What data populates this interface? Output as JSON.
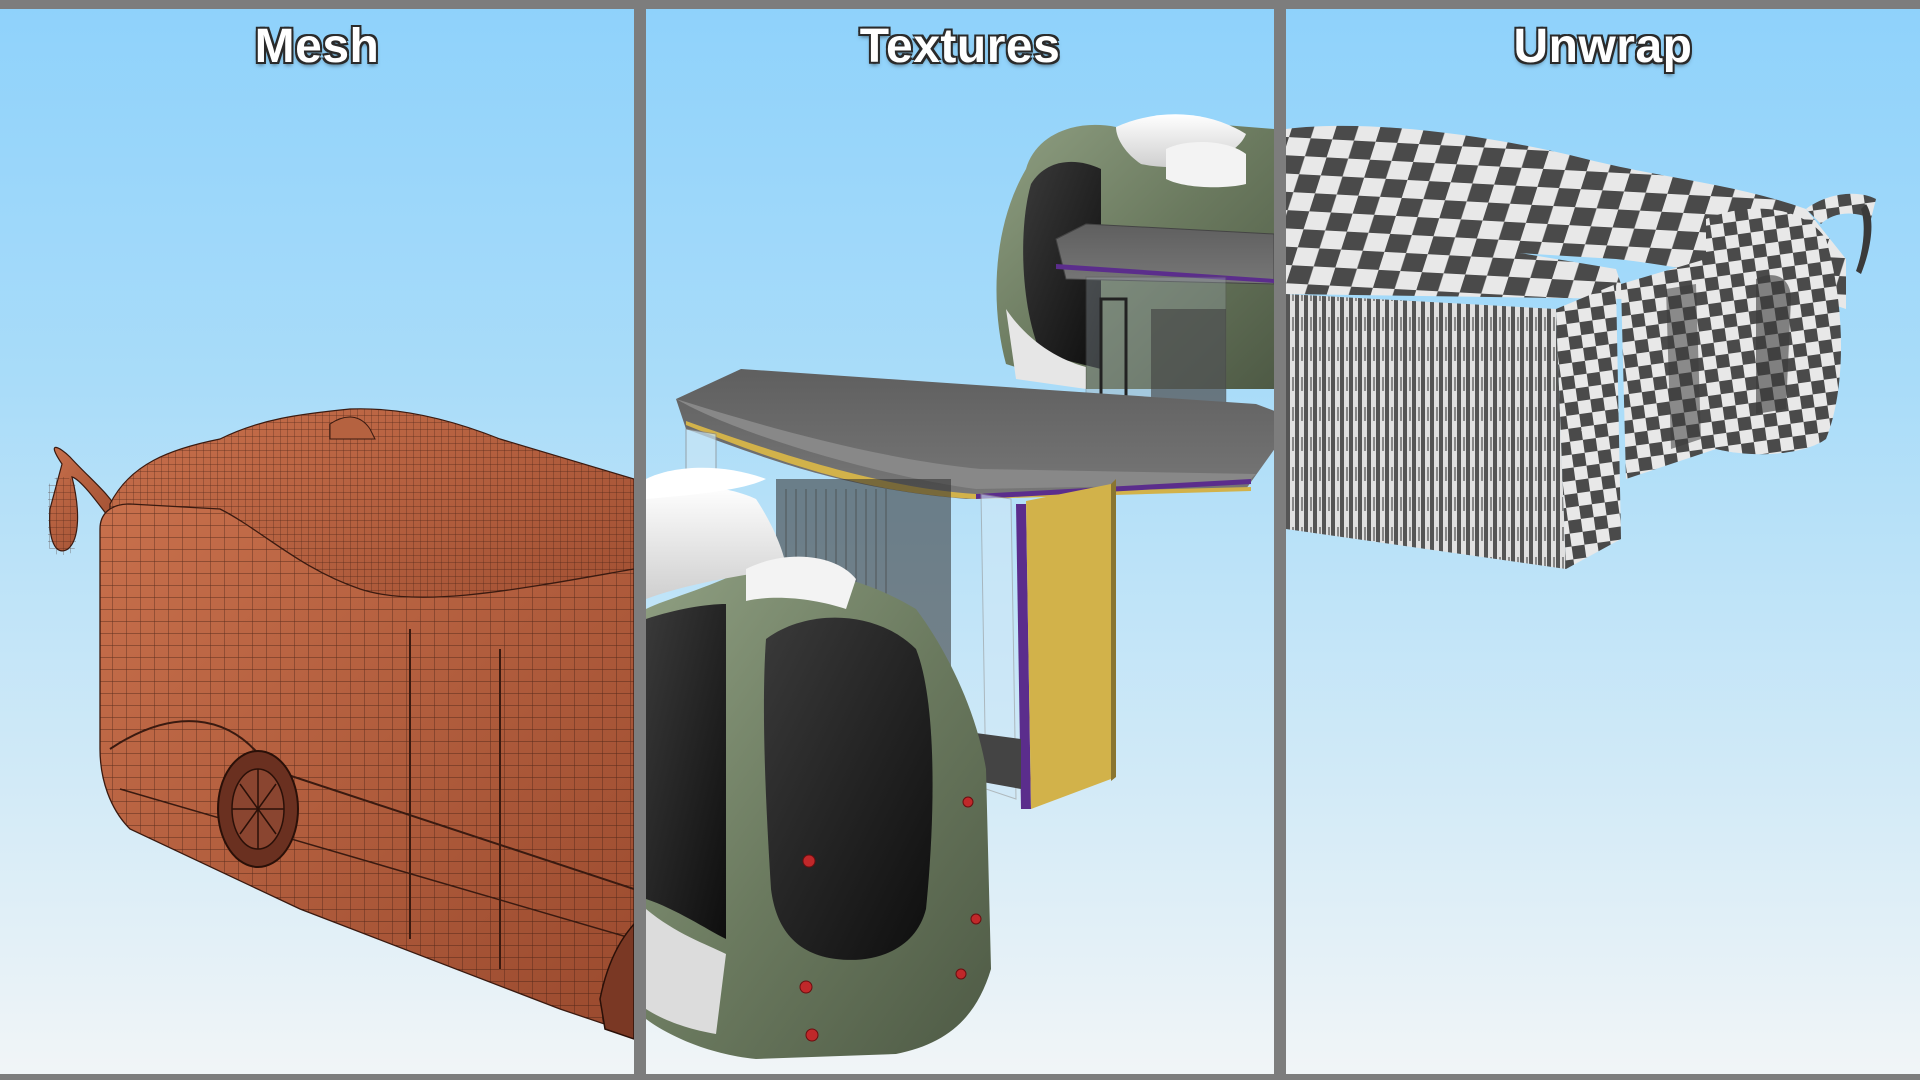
{
  "panels": [
    {
      "title": "Mesh",
      "render": "bus-wireframe-mesh"
    },
    {
      "title": "Textures",
      "render": "bus-and-shelter-textured"
    },
    {
      "title": "Unwrap",
      "render": "bus-uv-checker-unwrap"
    }
  ],
  "colors": {
    "background_frame": "#7d7d7d",
    "sky_top": "#8fd2fb",
    "sky_bottom": "#f1f5f7",
    "mesh_body": "#b05a3a",
    "bus_green": "#7a8a6e",
    "bus_white": "#e6e6e6",
    "shelter_roof": "#6d6d6d",
    "shelter_yellow": "#d2b24a",
    "shelter_purple": "#5b2d8c",
    "checker_dark": "#4a4a4a",
    "checker_light": "#e8e8e8"
  }
}
